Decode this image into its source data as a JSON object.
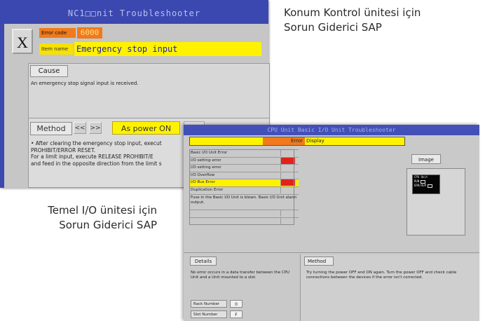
{
  "captions": {
    "top": [
      "Konum Kontrol ünitesi için",
      "Sorun Giderici SAP"
    ],
    "left": [
      "Temel I/O ünitesi için",
      "Sorun Giderici SAP"
    ]
  },
  "nc_window": {
    "title": "NC1□□nit Troubleshooter",
    "close_label": "X",
    "error_code_label": "Error code",
    "error_code_value": "6000",
    "item_name_label": "Item name",
    "item_name_value": "Emergency stop input",
    "cause_label": "Cause",
    "cause_text": "An emergency stop signal input is received.",
    "method_label": "Method",
    "prev_label": "<<",
    "next_label": ">>",
    "as_power_label": "As power ON",
    "method_text": [
      "• After clearing the emergency stop input, execut",
      "PROHIBIT/ERROR RESET.",
      "For a limit input, execute RELEASE PROHIBIT/E",
      "and feed in the opposite direction from the limit s"
    ]
  },
  "io_window": {
    "title": "CPU Unit Basic I/O Unit Troubleshooter",
    "error_header_label": "Error",
    "error_header_value": "Display",
    "error_list": [
      {
        "label": "Basic I/O Unit Error",
        "selected": false,
        "red": false
      },
      {
        "label": "I/O setting error",
        "selected": false,
        "red": true
      },
      {
        "label": "I/O setting error",
        "selected": false,
        "red": false
      },
      {
        "label": "I/O Overflow",
        "selected": false,
        "red": false
      },
      {
        "label": "I/O Bus Error",
        "selected": true,
        "red": true
      },
      {
        "label": "Duplication Error",
        "selected": false,
        "red": false
      }
    ],
    "list_note": "Fuse in the Basic I/O Unit is blown. Basic I/O Unit alarm output.",
    "image_label": "Image",
    "lcd_lines": [
      "CPU Unit",
      "RUN",
      "ERR/ALM"
    ],
    "details_label": "Details",
    "details_text": "No error occurs in a data transfer between the CPU Unit and a Unit mounted to a slot.",
    "rack_number_label": "Rack Number",
    "rack_number_value": "0",
    "slot_number_label": "Slot Number",
    "slot_number_value": "F",
    "method_label": "Method",
    "method_text": "Try turning the power OFF and ON again. Turn the power OFF and check cable connections between the devices if the error isn't corrected."
  },
  "colors": {
    "title_blue": "#3b48b0",
    "highlight_yellow": "#fff200",
    "label_orange": "#f07a1c",
    "error_red": "#e3211c",
    "panel_gray": "#c6c6c6"
  }
}
